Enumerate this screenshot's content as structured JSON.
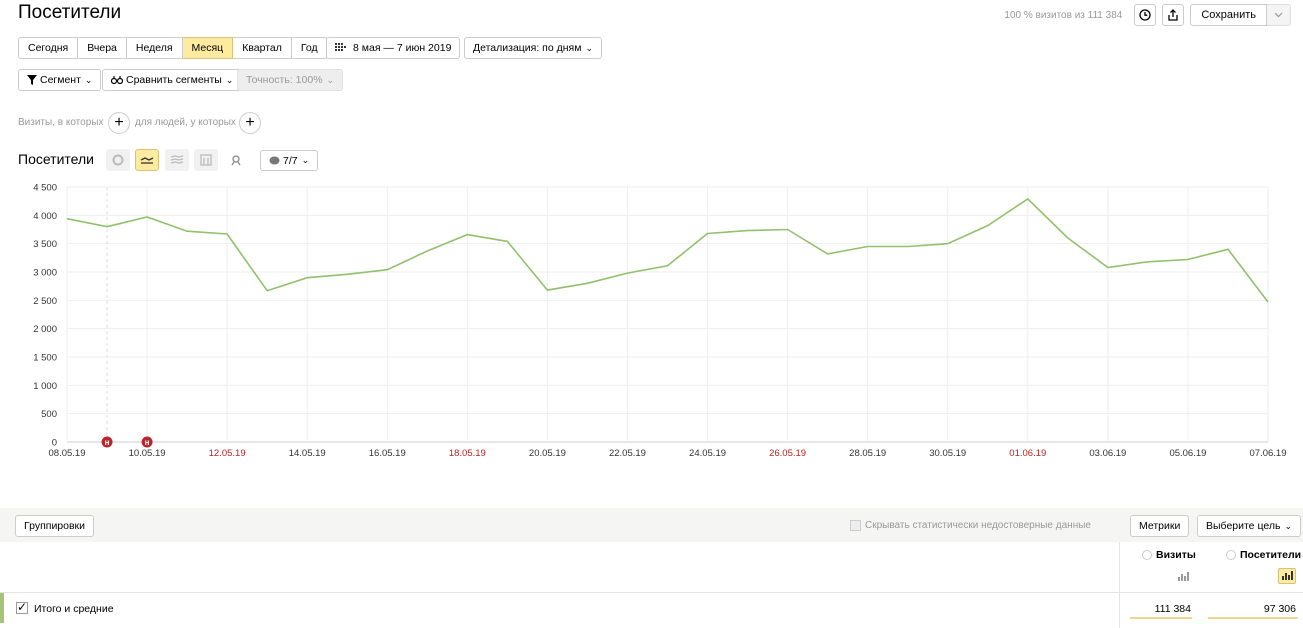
{
  "header": {
    "title": "Посетители",
    "visit_info": "100 % визитов из 111 384",
    "save_label": "Сохранить"
  },
  "periods": [
    "Сегодня",
    "Вчера",
    "Неделя",
    "Месяц",
    "Квартал",
    "Год"
  ],
  "active_period": "Месяц",
  "date_range": "8 мая — 7 июн 2019",
  "detail": "Детализация: по дням",
  "segment_label": "Сегмент",
  "compare_label": "Сравнить сегменты",
  "accuracy_label": "Точность: 100%",
  "filters": {
    "visits_label": "Визиты, в которых",
    "people_label": "для людей, у которых"
  },
  "chart_section": {
    "title": "Посетители",
    "series_count": "7/7"
  },
  "chart_data": {
    "type": "line",
    "ylim": [
      0,
      4500
    ],
    "yticks": [
      "4 500",
      "4 000",
      "3 500",
      "3 000",
      "2 500",
      "2 000",
      "1 500",
      "1 000",
      "500",
      "0"
    ],
    "xlabels": [
      {
        "text": "08.05.19",
        "holiday": false
      },
      {
        "text": "10.05.19",
        "holiday": false
      },
      {
        "text": "12.05.19",
        "holiday": true
      },
      {
        "text": "14.05.19",
        "holiday": false
      },
      {
        "text": "16.05.19",
        "holiday": false
      },
      {
        "text": "18.05.19",
        "holiday": true
      },
      {
        "text": "20.05.19",
        "holiday": false
      },
      {
        "text": "22.05.19",
        "holiday": false
      },
      {
        "text": "24.05.19",
        "holiday": false
      },
      {
        "text": "26.05.19",
        "holiday": true
      },
      {
        "text": "28.05.19",
        "holiday": false
      },
      {
        "text": "30.05.19",
        "holiday": false
      },
      {
        "text": "01.06.19",
        "holiday": true
      },
      {
        "text": "03.06.19",
        "holiday": false
      },
      {
        "text": "05.06.19",
        "holiday": false
      },
      {
        "text": "07.06.19",
        "holiday": false
      }
    ],
    "series": [
      {
        "color": "#91c16c",
        "values": [
          3940,
          3800,
          3970,
          3720,
          3670,
          2670,
          2900,
          2960,
          3040,
          3370,
          3660,
          3540,
          2680,
          2800,
          2980,
          3110,
          3680,
          3730,
          3750,
          3320,
          3450,
          3450,
          3500,
          3820,
          4290,
          3600,
          3080,
          3180,
          3220,
          3400,
          2470
        ]
      }
    ],
    "annotation_marker": "н",
    "annotations_at_index": [
      1,
      2
    ]
  },
  "table": {
    "group_label": "Группировки",
    "hide_label": "Скрывать статистически недостоверные данные",
    "metrics_label": "Метрики",
    "goal_label": "Выберите цель",
    "columns": [
      "Визиты",
      "Посетители"
    ],
    "total_label": "Итого и средние",
    "total_values": [
      "111 384",
      "97 306"
    ]
  }
}
